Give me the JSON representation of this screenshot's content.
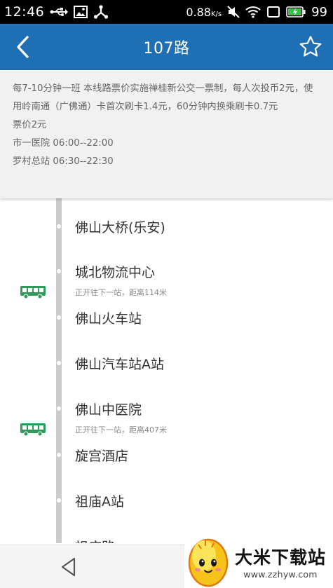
{
  "status_bar": {
    "time": "12:46",
    "net_speed": "0.88",
    "net_unit": "K/s",
    "battery_level": "99",
    "icons": [
      "usb-icon",
      "image-icon",
      "share-icon",
      "mute-icon",
      "wifi-icon",
      "screen-icon",
      "battery-icon"
    ]
  },
  "app_bar": {
    "title": "107路",
    "back_icon": "back-arrow-icon",
    "favorite_icon": "star-icon"
  },
  "info": {
    "description": "每7-10分钟一班 本线路票价实施禅桂新公交一票制，每人次投币2元，使用岭南通（广佛通）卡首次刷卡1.4元，60分钟内换乘刷卡0.7元",
    "fare": "票价2元",
    "schedules": [
      "市一医院 06:00--22:00",
      "罗村总站 06:30--22:30"
    ]
  },
  "stops": [
    {
      "name": "佛山大桥(乐安)"
    },
    {
      "name": "城北物流中心"
    },
    {
      "name": "佛山火车站"
    },
    {
      "name": "佛山汽车站A站"
    },
    {
      "name": "佛山中医院"
    },
    {
      "name": "旋宫酒店"
    },
    {
      "name": "祖庙A站"
    },
    {
      "name": "祖庙路"
    }
  ],
  "buses": [
    {
      "text": "正开往下一站，距离114米"
    },
    {
      "text": "正开往下一站，距离407米"
    }
  ],
  "colors": {
    "app_bar": "#1e6fb3",
    "bus_icon": "#2e9b58",
    "track": "#cccccc"
  },
  "watermark": {
    "name": "大米下载站",
    "url": "www.zzhyw.com"
  }
}
